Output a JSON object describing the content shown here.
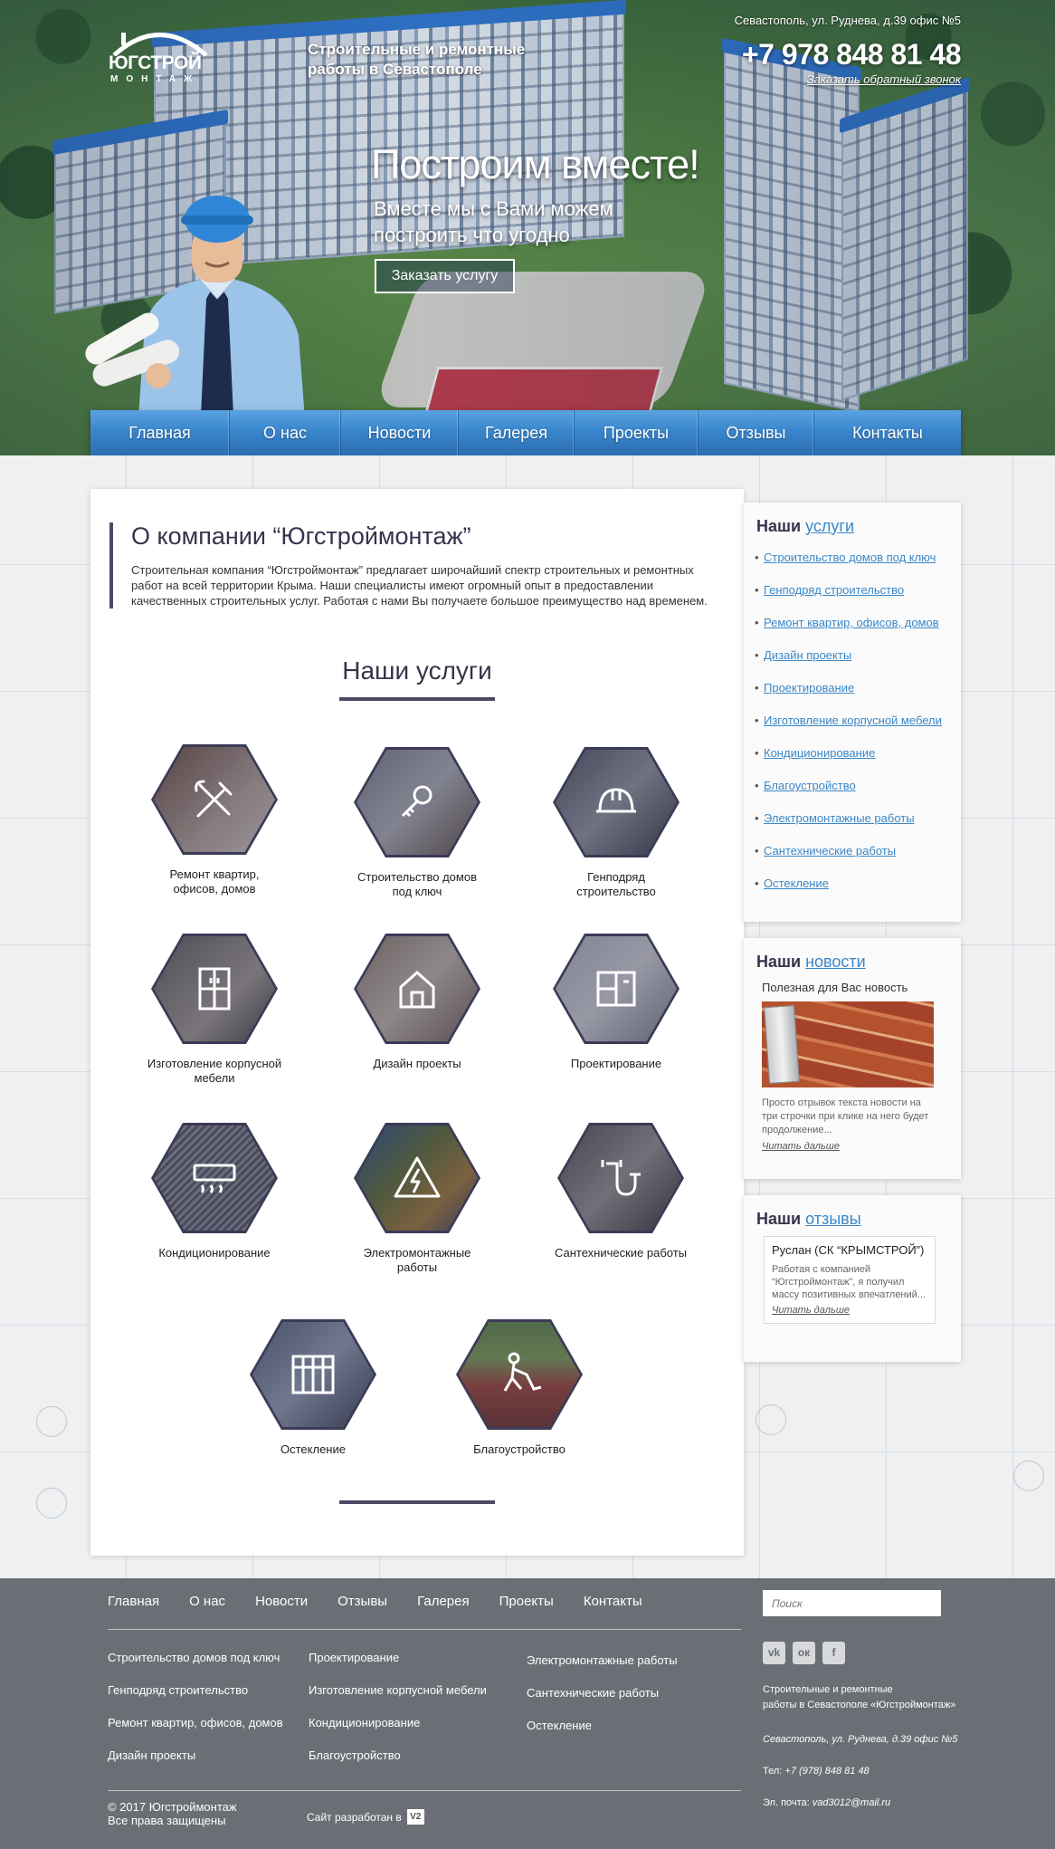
{
  "header": {
    "logo_text": "ЮГСТРОЙ",
    "logo_sub": "МОНТАЖ",
    "tagline": "Строительные и ремонтные работы в Севастополе",
    "address": "Севастополь, ул. Руднева, д.39 офис №5",
    "phone": "+7 978 848 81 48",
    "callback_link": "Заказать обратный звонок"
  },
  "hero": {
    "title": "Построим вместе!",
    "subtitle": "Вместе мы с Вами можем построить что угодно",
    "button": "Заказать услугу"
  },
  "nav": {
    "items": [
      {
        "label": "Главная"
      },
      {
        "label": "О нас"
      },
      {
        "label": "Новости"
      },
      {
        "label": "Галерея"
      },
      {
        "label": "Проекты"
      },
      {
        "label": "Отзывы"
      },
      {
        "label": "Контакты"
      }
    ]
  },
  "about": {
    "title": "О компании “Югстроймонтаж”",
    "text": "Строительная компания “Югстроймонтаж” предлагает широчайший спектр строительных и ремонтных работ на всей территории Крыма. Наши специалисты имеют огромный опыт в предоставлении качественных строительных услуг. Работая с нами Вы получаете большое преимущество над временем."
  },
  "services": {
    "title": "Наши услуги",
    "items": [
      {
        "label": "Ремонт квартир, офисов, домов",
        "icon": "tools-icon"
      },
      {
        "label": "Строительство домов под ключ",
        "icon": "key-icon"
      },
      {
        "label": "Генподряд строительство",
        "icon": "helmet-icon"
      },
      {
        "label": "Изготовление корпусной мебели",
        "icon": "wardrobe-icon"
      },
      {
        "label": "Дизайн проекты",
        "icon": "house-plan-icon"
      },
      {
        "label": "Проектирование",
        "icon": "blueprint-icon"
      },
      {
        "label": "Кондиционирование",
        "icon": "air-conditioner-icon"
      },
      {
        "label": "Электромонтажные работы",
        "icon": "lightning-icon"
      },
      {
        "label": "Сантехнические работы",
        "icon": "pipe-icon"
      },
      {
        "label": "Остекление",
        "icon": "window-icon"
      },
      {
        "label": "Благоустройство",
        "icon": "worker-shovel-icon"
      }
    ]
  },
  "sidebar": {
    "services": {
      "title_prefix": "Наши",
      "title_link": "услуги",
      "items": [
        "Строительство домов под ключ",
        "Генподряд строительство",
        "Ремонт квартир, офисов, домов",
        "Дизайн проекты",
        "Проектирование",
        "Изготовление корпусной мебели",
        "Кондиционирование",
        "Благоустройство",
        "Электромонтажные работы",
        "Сантехнические работы",
        "Остекление"
      ]
    },
    "news": {
      "title_prefix": "Наши",
      "title_link": "новости",
      "headline": "Полезная для Вас новость",
      "text": "Просто отрывок текста новости на три строчки при клике на него будет продолжение...",
      "read_more": "Читать дальше"
    },
    "reviews": {
      "title_prefix": "Наши",
      "title_link": "отзывы",
      "author": "Руслан (СК “КРЫМСТРОЙ”)",
      "text": "Работая с компанией “Югстроймонтаж”, я получил массу позитивных впечатлений...",
      "read_more": "Читать дальше"
    }
  },
  "footer": {
    "nav": [
      "Главная",
      "О нас",
      "Новости",
      "Отзывы",
      "Галерея",
      "Проекты",
      "Контакты"
    ],
    "col1": [
      "Строительство домов под ключ",
      "Генподряд строительство",
      "Ремонт квартир, офисов, домов",
      "Дизайн проекты"
    ],
    "col2": [
      "Проектирование",
      "Изготовление корпусной мебели",
      "Кондиционирование",
      "Благоустройство"
    ],
    "col3": [
      "Электромонтажные работы",
      "Сантехнические работы",
      "Остекление"
    ],
    "search_placeholder": "Поиск",
    "social": [
      {
        "icon": "vk-icon",
        "label": "vk"
      },
      {
        "icon": "odnoklassniki-icon",
        "label": "ок"
      },
      {
        "icon": "facebook-icon",
        "label": "f"
      }
    ],
    "company_line1": "Строительные и ремонтные",
    "company_line2": "работы в Севастополе «Югстроймонтаж»",
    "address": "Севастополь, ул. Руднева, д.39 офис №5",
    "phone_label": "Тел:",
    "phone": "+7 (978) 848 81 48",
    "email_label": "Эл. почта:",
    "email": "vad3012@mail.ru",
    "copyright": "© 2017 Югстроймонтаж",
    "rights": "Все права защищены",
    "dev_text": "Сайт разработан в",
    "dev_logo": "V2"
  },
  "colors": {
    "nav_blue": "#3a86cc",
    "accent_link": "#3a87c8",
    "dark_heading": "#34344c",
    "footer_bg": "#6b6f75"
  }
}
